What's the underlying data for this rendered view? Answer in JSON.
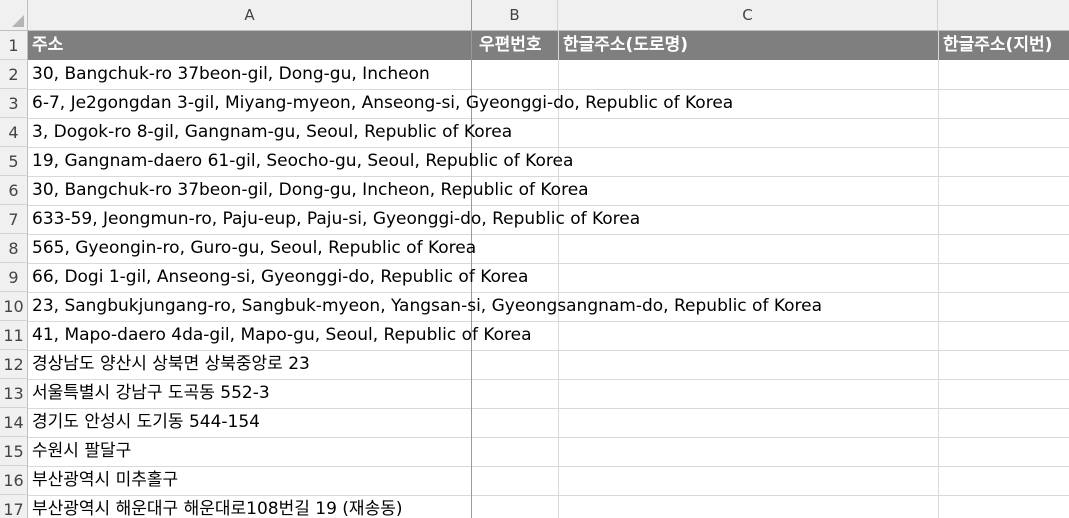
{
  "columns": [
    {
      "label": "A"
    },
    {
      "label": "B"
    },
    {
      "label": "C"
    }
  ],
  "header_row": {
    "row_number": "1",
    "cells": [
      "주소",
      "우편번호",
      "한글주소(도로명)",
      "한글주소(지번)"
    ]
  },
  "rows": [
    {
      "row_number": "2",
      "address": "30, Bangchuk-ro 37beon-gil, Dong-gu, Incheon"
    },
    {
      "row_number": "3",
      "address": "6-7, Je2gongdan 3-gil, Miyang-myeon, Anseong-si, Gyeonggi-do, Republic of Korea"
    },
    {
      "row_number": "4",
      "address": "3, Dogok-ro 8-gil, Gangnam-gu, Seoul, Republic of Korea"
    },
    {
      "row_number": "5",
      "address": "19, Gangnam-daero 61-gil, Seocho-gu, Seoul, Republic of Korea"
    },
    {
      "row_number": "6",
      "address": "30, Bangchuk-ro 37beon-gil, Dong-gu, Incheon, Republic of Korea"
    },
    {
      "row_number": "7",
      "address": "633-59, Jeongmun-ro, Paju-eup, Paju-si, Gyeonggi-do, Republic of Korea"
    },
    {
      "row_number": "8",
      "address": "565, Gyeongin-ro, Guro-gu, Seoul, Republic of Korea"
    },
    {
      "row_number": "9",
      "address": "66, Dogi 1-gil, Anseong-si, Gyeonggi-do, Republic of Korea"
    },
    {
      "row_number": "10",
      "address": "23, Sangbukjungang-ro, Sangbuk-myeon, Yangsan-si, Gyeongsangnam-do, Republic of Korea"
    },
    {
      "row_number": "11",
      "address": "41, Mapo-daero 4da-gil, Mapo-gu, Seoul, Republic of Korea"
    },
    {
      "row_number": "12",
      "address": "경상남도 양산시 상북면 상북중앙로 23"
    },
    {
      "row_number": "13",
      "address": "서울특별시 강남구 도곡동 552-3"
    },
    {
      "row_number": "14",
      "address": "경기도 안성시 도기동 544-154"
    },
    {
      "row_number": "15",
      "address": "수원시 팔달구"
    },
    {
      "row_number": "16",
      "address": "부산광역시 미추홀구"
    },
    {
      "row_number": "17",
      "address": "부산광역시 해운대구 해운대로108번길 19 (재송동)"
    }
  ]
}
